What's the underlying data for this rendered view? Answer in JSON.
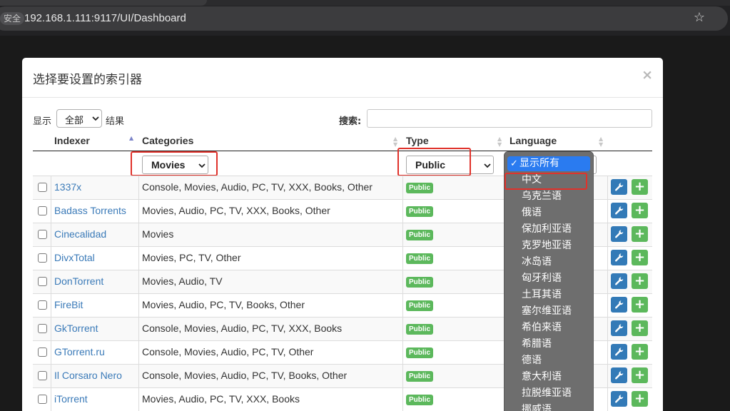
{
  "browser": {
    "security_label": "安全",
    "url": "192.168.1.111:9117/UI/Dashboard"
  },
  "modal": {
    "title": "选择要设置的索引器",
    "close_glyph": "×"
  },
  "length": {
    "prefix": "显示",
    "value": "全部",
    "suffix": "结果"
  },
  "search": {
    "label": "搜索:",
    "value": ""
  },
  "table": {
    "headers": {
      "indexer": "Indexer",
      "categories": "Categories",
      "type": "Type",
      "language": "Language"
    },
    "filters": {
      "categories": "Movies",
      "type": "Public"
    },
    "rows": [
      {
        "name": "1337x",
        "categories": "Console, Movies, Audio, PC, TV, XXX, Books, Other",
        "type": "Public"
      },
      {
        "name": "Badass Torrents",
        "categories": "Movies, Audio, PC, TV, XXX, Books, Other",
        "type": "Public"
      },
      {
        "name": "Cinecalidad",
        "categories": "Movies",
        "type": "Public"
      },
      {
        "name": "DivxTotal",
        "categories": "Movies, PC, TV, Other",
        "type": "Public"
      },
      {
        "name": "DonTorrent",
        "categories": "Movies, Audio, TV",
        "type": "Public"
      },
      {
        "name": "FireBit",
        "categories": "Movies, Audio, PC, TV, Books, Other",
        "type": "Public"
      },
      {
        "name": "GkTorrent",
        "categories": "Console, Movies, Audio, PC, TV, XXX, Books",
        "type": "Public"
      },
      {
        "name": "GTorrent.ru",
        "categories": "Console, Movies, Audio, PC, TV, Other",
        "type": "Public"
      },
      {
        "name": "Il Corsaro Nero",
        "categories": "Console, Movies, Audio, PC, TV, Books, Other",
        "type": "Public"
      },
      {
        "name": "iTorrent",
        "categories": "Movies, Audio, PC, TV, XXX, Books",
        "type": "Public"
      }
    ]
  },
  "language_dropdown": {
    "selected_mark": "✓",
    "options": [
      "显示所有",
      "中文",
      "乌克兰语",
      "俄语",
      "保加利亚语",
      "克罗地亚语",
      "冰岛语",
      "匈牙利语",
      "土耳其语",
      "塞尔维亚语",
      "希伯来语",
      "希腊语",
      "德语",
      "意大利语",
      "拉脱维亚语",
      "挪威语"
    ]
  },
  "colors": {
    "link": "#3a7ab8",
    "badge_public": "#5cb85c",
    "configure_button": "#337ab7",
    "add_button": "#5cb85c",
    "highlight": "#e0322b",
    "dropdown_selected": "#2a7bf0"
  },
  "icons": {
    "configure": "wrench-icon",
    "add": "plus-icon",
    "close": "close-icon",
    "bookmark": "star-icon",
    "sort": "sort-icon"
  }
}
